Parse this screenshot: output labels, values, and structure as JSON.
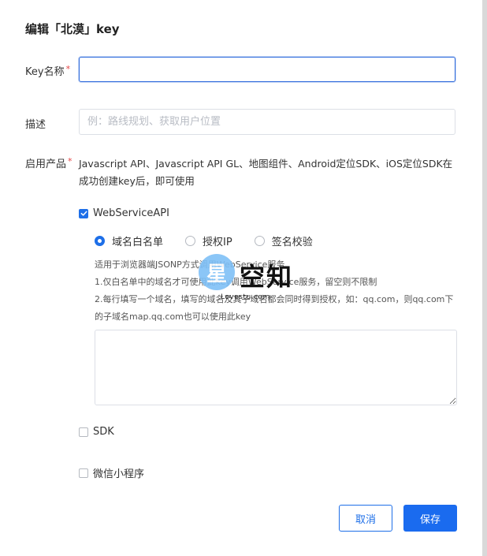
{
  "dialog": {
    "title": "编辑「北漠」key"
  },
  "form": {
    "key_name": {
      "label": "Key名称",
      "required": "*",
      "value": ""
    },
    "description": {
      "label": "描述",
      "placeholder": "例：路线规划、获取用户位置",
      "value": ""
    },
    "products": {
      "label": "启用产品",
      "required": "*",
      "desc": "Javascript API、Javascript API GL、地图组件、Android定位SDK、iOS定位SDK在成功创建key后，即可使用"
    },
    "webservice": {
      "label": "WebServiceAPI",
      "checked": true,
      "radios": [
        {
          "label": "域名白名单",
          "selected": true
        },
        {
          "label": "授权IP",
          "selected": false
        },
        {
          "label": "签名校验",
          "selected": false
        }
      ],
      "help": [
        "适用于浏览器端JSONP方式调用WebService服务",
        "1.仅白名单中的域名才可使用此key调用WebService服务，留空则不限制",
        "2.每行填写一个域名，填写的域名及其子域名都会同时得到授权，如：qq.com，则qq.com下的子域名map.qq.com也可以使用此key"
      ]
    },
    "sdk": {
      "label": "SDK",
      "checked": false
    },
    "miniprogram": {
      "label": "微信小程序",
      "checked": false
    }
  },
  "buttons": {
    "cancel": "取消",
    "save": "保存"
  },
  "watermark": {
    "star": "星",
    "text": "空知",
    "sub": "Lovestu.com"
  },
  "colors": {
    "primary": "#1e6fe8",
    "required": "#e54545"
  }
}
